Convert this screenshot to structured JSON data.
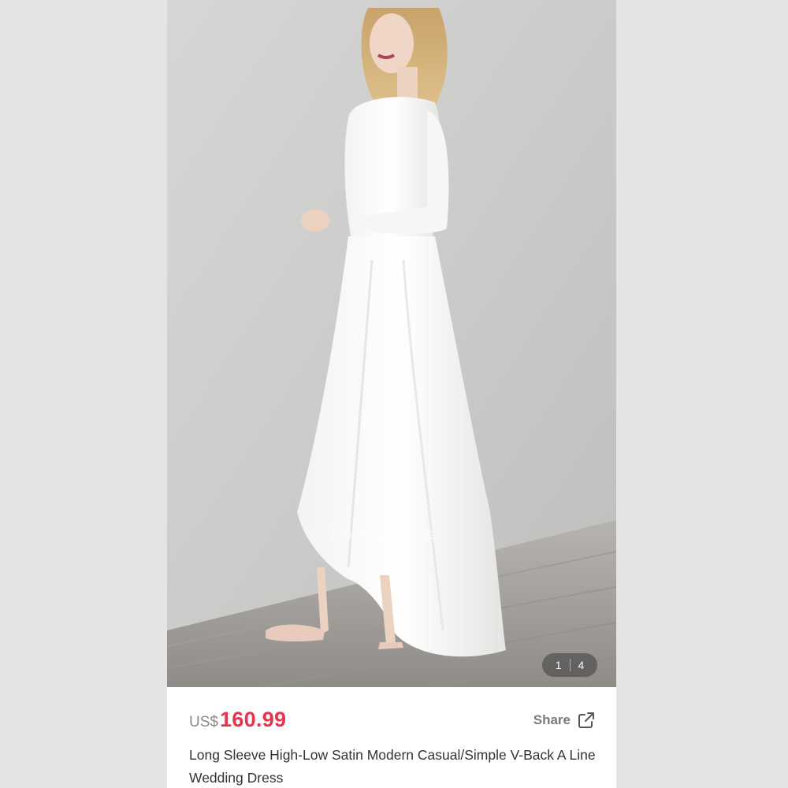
{
  "gallery": {
    "current": "1",
    "total": "4",
    "watermark": "Dorriswedding"
  },
  "product": {
    "currency": "US$",
    "price": "160.99",
    "title": "Long Sleeve High-Low Satin Modern Casual/Simple V-Back A Line Wedding Dress"
  },
  "actions": {
    "share_label": "Share"
  },
  "colors": {
    "price": "#e8334f",
    "background": "#e4e4e4"
  }
}
